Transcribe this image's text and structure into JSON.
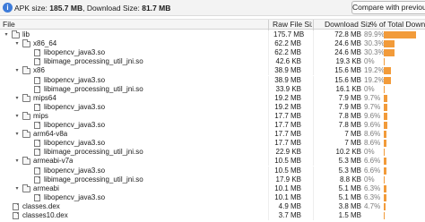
{
  "summary": {
    "apk_label": "APK size:",
    "apk_size": "185.7 MB",
    "download_label": ", Download Size:",
    "download_size": "81.7 MB",
    "compare_button": "Compare with previous APK..."
  },
  "columns": {
    "file": "File",
    "raw": "Raw File Size",
    "download": "Download Size",
    "percent": "% of Total Download S"
  },
  "colors": {
    "bar": "#f29b3a"
  },
  "rows": [
    {
      "name": "lib",
      "type": "folder",
      "depth": 0,
      "expanded": true,
      "raw": "175.7 MB",
      "dl": "72.8 MB",
      "pct": "89.9%",
      "pct_value": 89.9
    },
    {
      "name": "x86_64",
      "type": "folder",
      "depth": 1,
      "expanded": true,
      "raw": "62.2 MB",
      "dl": "24.6 MB",
      "pct": "30.3%",
      "pct_value": 30.3
    },
    {
      "name": "libopencv_java3.so",
      "type": "file",
      "depth": 2,
      "raw": "62.2 MB",
      "dl": "24.6 MB",
      "pct": "30.3%",
      "pct_value": 30.3
    },
    {
      "name": "libimage_processing_util_jni.so",
      "type": "file",
      "depth": 2,
      "raw": "42.6 KB",
      "dl": "19.3 KB",
      "pct": "0%",
      "pct_value": 0
    },
    {
      "name": "x86",
      "type": "folder",
      "depth": 1,
      "expanded": true,
      "raw": "38.9 MB",
      "dl": "15.6 MB",
      "pct": "19.2%",
      "pct_value": 19.2
    },
    {
      "name": "libopencv_java3.so",
      "type": "file",
      "depth": 2,
      "raw": "38.9 MB",
      "dl": "15.6 MB",
      "pct": "19.2%",
      "pct_value": 19.2
    },
    {
      "name": "libimage_processing_util_jni.so",
      "type": "file",
      "depth": 2,
      "raw": "33.9 KB",
      "dl": "16.1 KB",
      "pct": "0%",
      "pct_value": 0
    },
    {
      "name": "mips64",
      "type": "folder",
      "depth": 1,
      "expanded": true,
      "raw": "19.2 MB",
      "dl": "7.9 MB",
      "pct": "9.7%",
      "pct_value": 9.7
    },
    {
      "name": "libopencv_java3.so",
      "type": "file",
      "depth": 2,
      "raw": "19.2 MB",
      "dl": "7.9 MB",
      "pct": "9.7%",
      "pct_value": 9.7
    },
    {
      "name": "mips",
      "type": "folder",
      "depth": 1,
      "expanded": true,
      "raw": "17.7 MB",
      "dl": "7.8 MB",
      "pct": "9.6%",
      "pct_value": 9.6
    },
    {
      "name": "libopencv_java3.so",
      "type": "file",
      "depth": 2,
      "raw": "17.7 MB",
      "dl": "7.8 MB",
      "pct": "9.6%",
      "pct_value": 9.6
    },
    {
      "name": "arm64-v8a",
      "type": "folder",
      "depth": 1,
      "expanded": true,
      "raw": "17.7 MB",
      "dl": "7 MB",
      "pct": "8.6%",
      "pct_value": 8.6
    },
    {
      "name": "libopencv_java3.so",
      "type": "file",
      "depth": 2,
      "raw": "17.7 MB",
      "dl": "7 MB",
      "pct": "8.6%",
      "pct_value": 8.6
    },
    {
      "name": "libimage_processing_util_jni.so",
      "type": "file",
      "depth": 2,
      "raw": "22.9 KB",
      "dl": "10.2 KB",
      "pct": "0%",
      "pct_value": 0
    },
    {
      "name": "armeabi-v7a",
      "type": "folder",
      "depth": 1,
      "expanded": true,
      "raw": "10.5 MB",
      "dl": "5.3 MB",
      "pct": "6.6%",
      "pct_value": 6.6
    },
    {
      "name": "libopencv_java3.so",
      "type": "file",
      "depth": 2,
      "raw": "10.5 MB",
      "dl": "5.3 MB",
      "pct": "6.6%",
      "pct_value": 6.6
    },
    {
      "name": "libimage_processing_util_jni.so",
      "type": "file",
      "depth": 2,
      "raw": "17.9 KB",
      "dl": "8.8 KB",
      "pct": "0%",
      "pct_value": 0
    },
    {
      "name": "armeabi",
      "type": "folder",
      "depth": 1,
      "expanded": true,
      "raw": "10.1 MB",
      "dl": "5.1 MB",
      "pct": "6.3%",
      "pct_value": 6.3
    },
    {
      "name": "libopencv_java3.so",
      "type": "file",
      "depth": 2,
      "raw": "10.1 MB",
      "dl": "5.1 MB",
      "pct": "6.3%",
      "pct_value": 6.3
    },
    {
      "name": "classes.dex",
      "type": "file",
      "depth": 0,
      "raw": "4.9 MB",
      "dl": "3.8 MB",
      "pct": "4.7%",
      "pct_value": 4.7
    },
    {
      "name": "classes10.dex",
      "type": "file",
      "depth": 0,
      "raw": "3.7 MB",
      "dl": "1.5 MB",
      "pct": "",
      "pct_value": 1.8
    }
  ]
}
